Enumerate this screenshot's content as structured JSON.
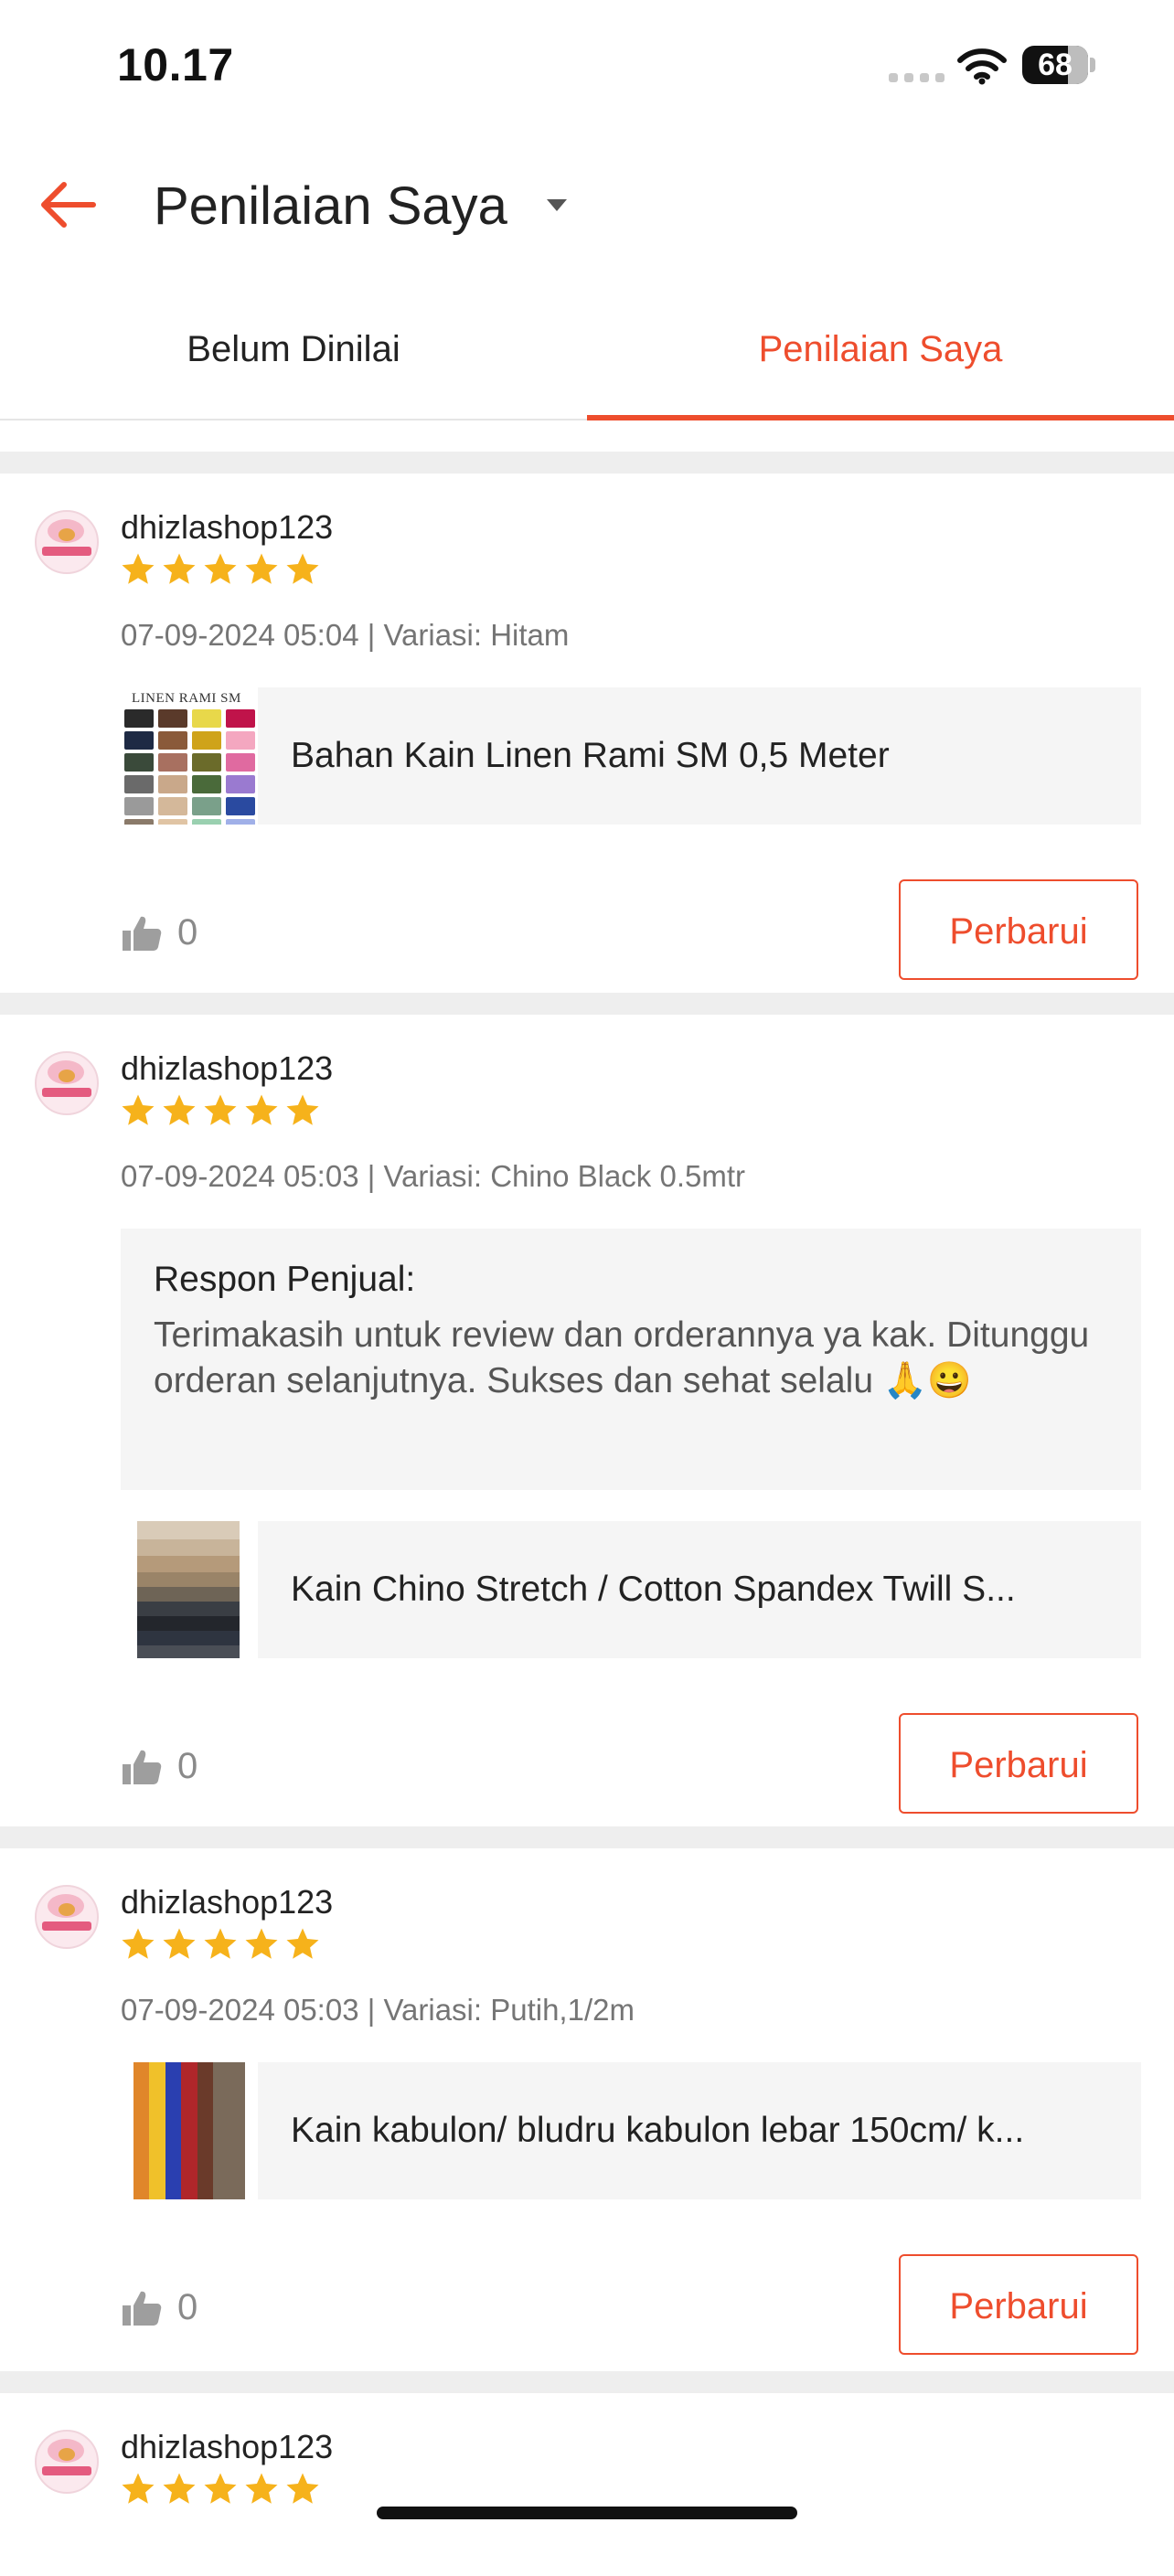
{
  "status_bar": {
    "time": "10.17",
    "battery": "68",
    "battery_level_percent": 68
  },
  "header": {
    "title": "Penilaian Saya",
    "back_icon": "arrow-left-icon",
    "dropdown_icon": "caret-down-icon"
  },
  "colors": {
    "accent": "#ee4d2d",
    "star": "#f6b21b",
    "separator": "#eeeeee"
  },
  "tabs": [
    {
      "label": "Belum Dinilai",
      "active": false
    },
    {
      "label": "Penilaian Saya",
      "active": true
    }
  ],
  "reviews": [
    {
      "username": "dhizlashop123",
      "rating": 5,
      "meta": "07-09-2024 05:04 | Variasi: Hitam",
      "product_name": "Bahan Kain Linen Rami SM 0,5 Meter",
      "thumb_label": "LINEN RAMI SM",
      "likes": "0",
      "button_label": "Perbarui"
    },
    {
      "username": "dhizlashop123",
      "rating": 5,
      "meta": "07-09-2024 05:03 | Variasi: Chino Black 0.5mtr",
      "seller_response": {
        "title": "Respon Penjual:",
        "text": "Terimakasih untuk review dan orderannya ya kak. Ditunggu orderan selanjutnya. Sukses dan sehat selalu 🙏😀"
      },
      "product_name": "Kain Chino Stretch / Cotton Spandex Twill S...",
      "likes": "0",
      "button_label": "Perbarui"
    },
    {
      "username": "dhizlashop123",
      "rating": 5,
      "meta": "07-09-2024 05:03 | Variasi: Putih,1/2m",
      "product_name": "Kain kabulon/ bludru kabulon lebar 150cm/ k...",
      "likes": "0",
      "button_label": "Perbarui"
    },
    {
      "username": "dhizlashop123",
      "rating": 5
    }
  ]
}
